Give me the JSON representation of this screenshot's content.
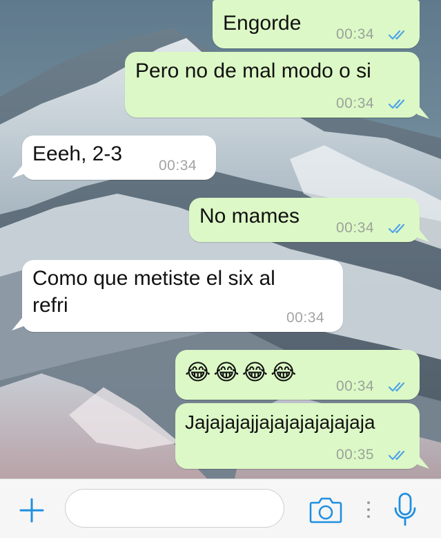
{
  "messages": [
    {
      "direction": "outgoing",
      "text": "Engorde",
      "time": "00:34",
      "status": "read"
    },
    {
      "direction": "outgoing",
      "text": "Pero no de mal modo o si",
      "time": "00:34",
      "status": "read"
    },
    {
      "direction": "incoming",
      "text": "Eeeh, 2-3",
      "time": "00:34"
    },
    {
      "direction": "outgoing",
      "text": "No mames",
      "time": "00:34",
      "status": "read"
    },
    {
      "direction": "incoming",
      "text_line1": "Como que metiste el six al",
      "text_line2": "refri",
      "time": "00:34"
    },
    {
      "direction": "outgoing",
      "text": "😂😂😂😂",
      "time": "00:34",
      "status": "read"
    },
    {
      "direction": "outgoing",
      "text": "Jajajajajjajajajajajajaja",
      "time": "00:35",
      "status": "read"
    }
  ],
  "composer": {
    "attach_icon": "plus-icon",
    "input_value": "",
    "camera_icon": "camera-icon",
    "mic_icon": "microphone-icon"
  },
  "colors": {
    "outgoing_bubble": "#dcf8c6",
    "incoming_bubble": "#ffffff",
    "tick_read": "#4fa3e8",
    "accent": "#1f8fe0"
  }
}
